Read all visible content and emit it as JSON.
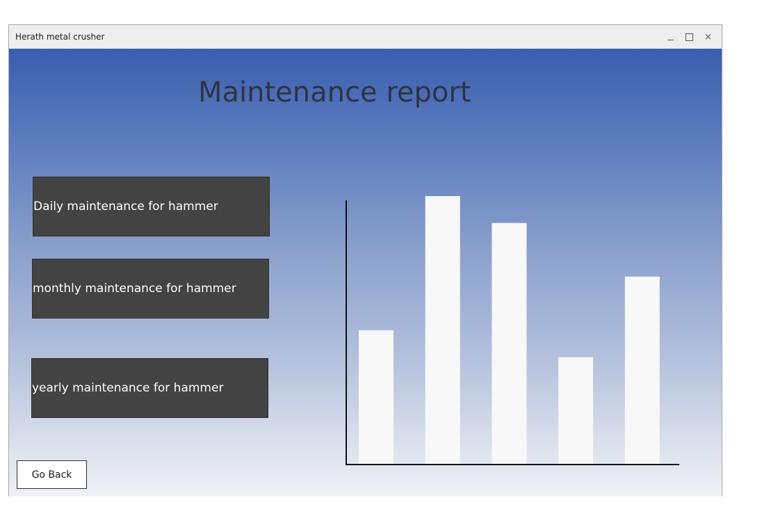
{
  "window": {
    "title": "Herath metal crusher"
  },
  "controls": {
    "minimize": "minimize-icon",
    "maximize": "maximize-icon",
    "close": "close-icon",
    "close_glyph": "×"
  },
  "main": {
    "heading": "Maintenance report",
    "buttons": [
      {
        "label": "Daily maintenance for hammer"
      },
      {
        "label": "monthly maintenance for hammer"
      },
      {
        "label": "yearly maintenance for hammer"
      }
    ],
    "back_label": "Go Back"
  },
  "chart_data": {
    "type": "bar",
    "categories": [
      "",
      "",
      "",
      "",
      ""
    ],
    "values": [
      50,
      100,
      90,
      40,
      70
    ],
    "ylim": [
      0,
      100
    ],
    "title": "",
    "xlabel": "",
    "ylabel": "",
    "grid": false,
    "bar_color": "#f8f8f8",
    "axis_color": "#111111"
  },
  "colors": {
    "button_bg": "#434343",
    "button_text": "#ffffff",
    "heading": "#2e3345",
    "gradient_top": "#3a5eae",
    "gradient_bottom": "#f0f1f5"
  }
}
